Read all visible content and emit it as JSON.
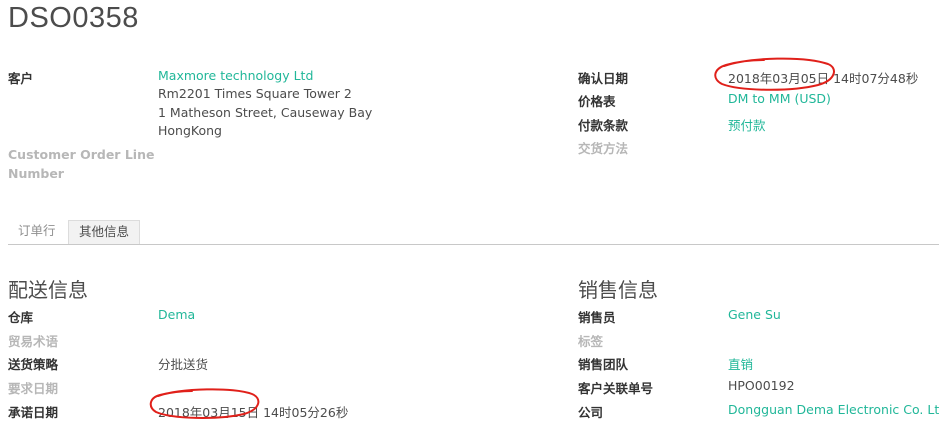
{
  "record": {
    "title": "DSO0358"
  },
  "left_info": {
    "customer_label": "客户",
    "customer_name": "Maxmore technology Ltd",
    "address_line1": "Rm2201 Times Square Tower 2",
    "address_line2": "1 Matheson Street, Causeway Bay",
    "address_line3": "HongKong",
    "customer_order_line_label_1": "Customer Order Line",
    "customer_order_line_label_2": "Number"
  },
  "right_info": {
    "confirm_date_label": "确认日期",
    "confirm_date_value": "2018年03月05日 14时07分48秒",
    "pricelist_label": "价格表",
    "pricelist_value": "DM to MM (USD)",
    "payment_terms_label": "付款条款",
    "payment_terms_value": "预付款",
    "delivery_method_label": "交货方法"
  },
  "tabs": [
    {
      "label": "订单行",
      "active": false
    },
    {
      "label": "其他信息",
      "active": true
    }
  ],
  "shipping_section": {
    "title": "配送信息",
    "warehouse_label": "仓库",
    "warehouse_value": "Dema",
    "incoterms_label": "贸易术语",
    "shipping_policy_label": "送货策略",
    "shipping_policy_value": "分批送货",
    "requested_date_label": "要求日期",
    "commitment_date_label": "承诺日期",
    "commitment_date_value": "2018年03月15日 14时05分26秒"
  },
  "sales_section": {
    "title": "销售信息",
    "salesperson_label": "销售员",
    "salesperson_value": "Gene Su",
    "tags_label": "标签",
    "sales_team_label": "销售团队",
    "sales_team_value": "直销",
    "customer_ref_label": "客户关联单号",
    "customer_ref_value": "HPO00192",
    "company_label": "公司",
    "company_value": "Dongguan Dema Electronic Co. Ltd."
  },
  "colors": {
    "link": "#21b799",
    "annotation": "#e0201a",
    "muted": "#b7b7b7"
  }
}
